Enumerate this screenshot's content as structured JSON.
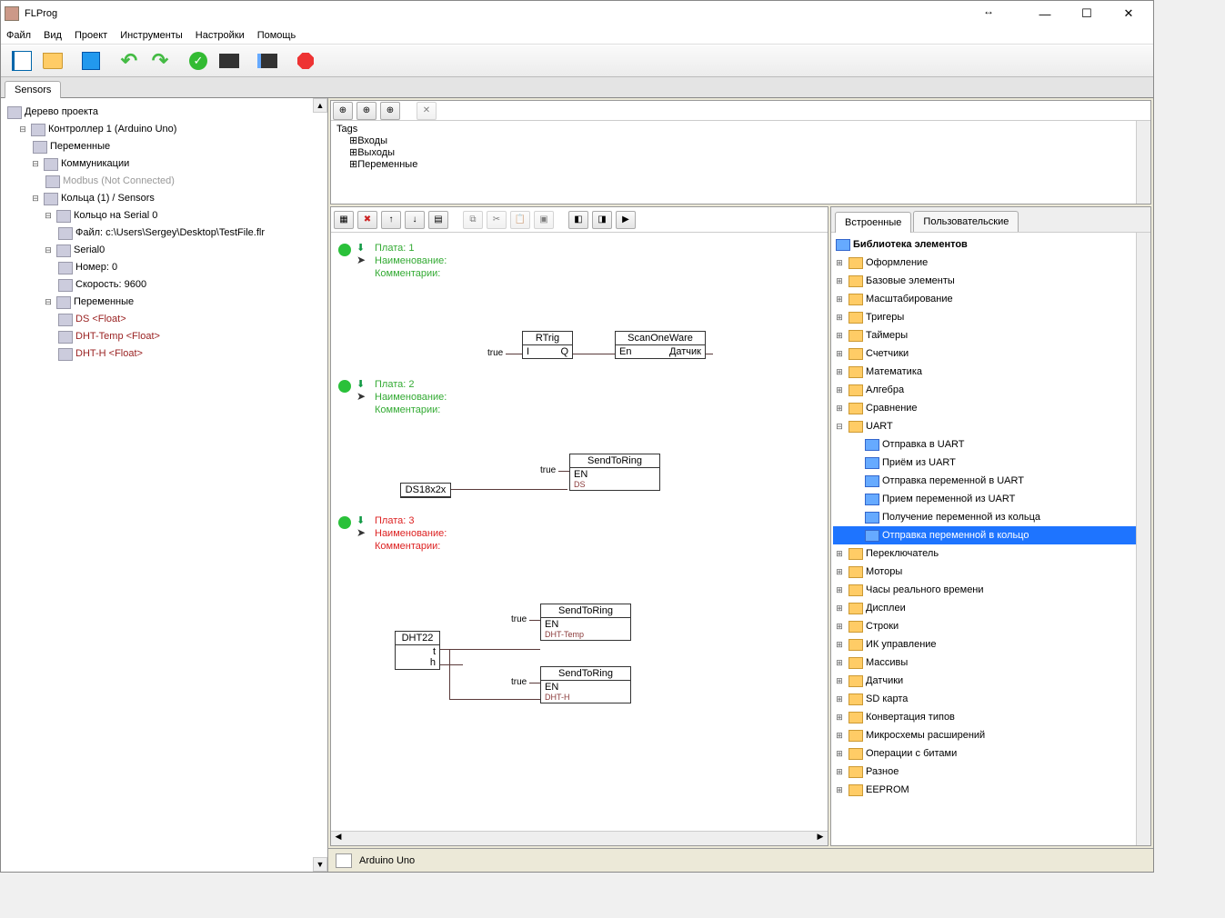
{
  "window": {
    "title": "FLProg"
  },
  "menu": {
    "file": "Файл",
    "view": "Вид",
    "project": "Проект",
    "tools": "Инструменты",
    "settings": "Настройки",
    "help": "Помощь"
  },
  "tabstrip": {
    "active": "Sensors"
  },
  "project_tree": {
    "root": "Дерево проекта",
    "controller": "Контроллер 1 (Arduino Uno)",
    "variables": "Переменные",
    "communications": "Коммуникации",
    "modbus": "Modbus (Not Connected)",
    "rings": "Кольца (1) / Sensors",
    "ring0": "Кольцо  на Serial 0",
    "file": "Файл: c:\\Users\\Sergey\\Desktop\\TestFile.flr",
    "serial0": "Serial0",
    "number": "Номер: 0",
    "speed": "Скорость: 9600",
    "ring_vars": "Переменные",
    "var_ds": "DS <Float>",
    "var_dht_temp": "DHT-Temp <Float>",
    "var_dht_h": "DHT-H <Float>"
  },
  "tags_panel": {
    "tags": "Tags",
    "inputs": "Входы",
    "outputs": "Выходы",
    "variables": "Переменные"
  },
  "boards": {
    "b1": {
      "plate": "Плата: 1",
      "name": "Наименование:",
      "comment": "Комментарии:"
    },
    "b2": {
      "plate": "Плата: 2",
      "name": "Наименование:",
      "comment": "Комментарии:"
    },
    "b3": {
      "plate": "Плата: 3",
      "name": "Наименование:",
      "comment": "Комментарии:"
    }
  },
  "blocks": {
    "rtrig": {
      "title": "RTrig",
      "in": "I",
      "out": "Q",
      "in_sig": "true"
    },
    "scanonewire": {
      "title": "ScanOneWare",
      "in": "En",
      "out": "Датчик"
    },
    "ds18": {
      "title": "DS18x2x",
      "in_sig": "true"
    },
    "sendtoring_ds": {
      "title": "SendToRing",
      "in": "EN",
      "out": "DS"
    },
    "dht22": {
      "title": "DHT22",
      "out_t": "t",
      "out_h": "h"
    },
    "sendtoring_t": {
      "title": "SendToRing",
      "in": "EN",
      "in_sig": "true",
      "out": "DHT-Temp"
    },
    "sendtoring_h": {
      "title": "SendToRing",
      "in": "EN",
      "in_sig": "true",
      "out": "DHT-H"
    }
  },
  "library": {
    "tab_builtin": "Встроенные",
    "tab_user": "Пользовательские",
    "header": "Библиотека элементов",
    "items": {
      "oformlenie": "Оформление",
      "basic": "Базовые элементы",
      "scaling": "Масштабирование",
      "triggers": "Тригеры",
      "timers": "Таймеры",
      "counters": "Счетчики",
      "math": "Математика",
      "algebra": "Алгебра",
      "compare": "Сравнение",
      "uart": "UART",
      "uart_send": "Отправка в UART",
      "uart_recv": "Приём из UART",
      "uart_sendvar": "Отправка переменной в UART",
      "uart_recvvar": "Прием переменной из UART",
      "ring_recvvar": "Получение переменной из кольца",
      "ring_sendvar": "Отправка переменной в кольцо",
      "switch": "Переключатель",
      "motors": "Моторы",
      "rtc": "Часы реального времени",
      "displays": "Дисплеи",
      "strings": "Строки",
      "ir": "ИК управление",
      "arrays": "Массивы",
      "sensors": "Датчики",
      "sdcard": "SD карта",
      "convert": "Конвертация типов",
      "expanders": "Микросхемы расширений",
      "bitops": "Операции с битами",
      "misc": "Разное",
      "eeprom": "EEPROM"
    }
  },
  "statusbar": {
    "board": "Arduino Uno"
  }
}
